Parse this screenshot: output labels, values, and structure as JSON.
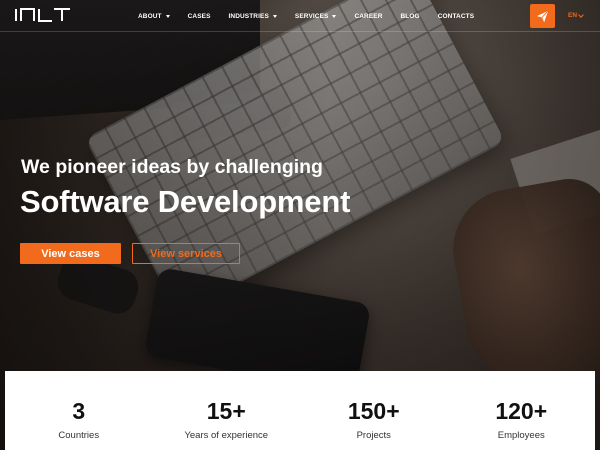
{
  "nav": {
    "items": [
      {
        "label": "ABOUT",
        "dropdown": true
      },
      {
        "label": "CASES",
        "dropdown": false
      },
      {
        "label": "INDUSTRIES",
        "dropdown": true
      },
      {
        "label": "SERVICES",
        "dropdown": true
      },
      {
        "label": "CAREER",
        "dropdown": false
      },
      {
        "label": "BLOG",
        "dropdown": false
      },
      {
        "label": "CONTACTS",
        "dropdown": false
      }
    ],
    "language": "EN",
    "contact_icon": "paper-plane-icon"
  },
  "hero": {
    "headline_line1": "We pioneer ideas by challenging",
    "headline_line2": "Software Development",
    "primary_button": "View cases",
    "secondary_button": "View services"
  },
  "stats": [
    {
      "value": "3",
      "label": "Countries"
    },
    {
      "value": "15+",
      "label": "Years of experience"
    },
    {
      "value": "150+",
      "label": "Projects"
    },
    {
      "value": "120+",
      "label": "Employees"
    }
  ],
  "colors": {
    "accent": "#f26a1b",
    "text_light": "#ffffff",
    "stats_bg": "#ffffff"
  }
}
